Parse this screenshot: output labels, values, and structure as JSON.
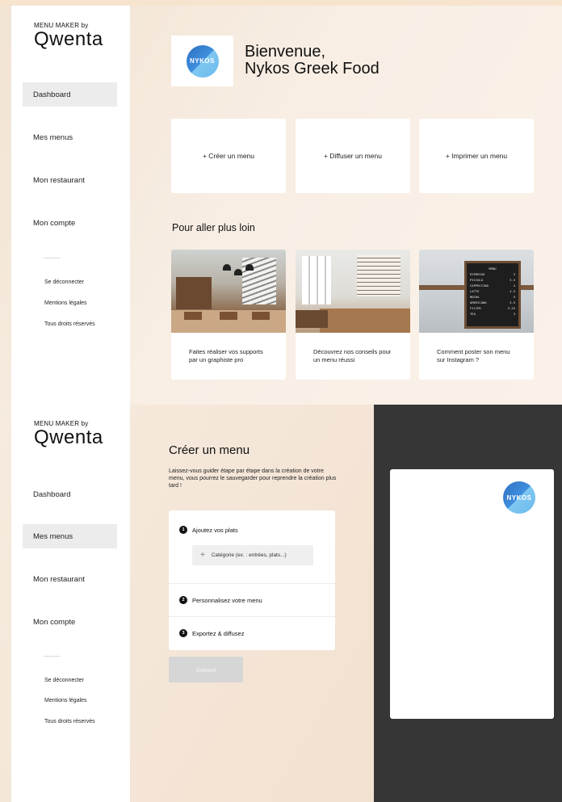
{
  "brand": {
    "small": "MENU MAKER by",
    "big": "Qwenta"
  },
  "screen1": {
    "sidebar": {
      "items": [
        {
          "label": "Dashboard",
          "active": true
        },
        {
          "label": "Mes menus",
          "active": false
        },
        {
          "label": "Mon restaurant",
          "active": false
        },
        {
          "label": "Mon compte",
          "active": false
        }
      ],
      "footer": [
        "Se déconnecter",
        "Mentions légales",
        "Tous droits réservés"
      ]
    },
    "logo_text": "NYKOS",
    "welcome": {
      "line1": "Bienvenue,",
      "line2": "Nykos Greek Food"
    },
    "actions": [
      "+ Créer un menu",
      "+ Diffuser un menu",
      "+ Imprimer un menu"
    ],
    "section_title": "Pour aller plus loin",
    "cards": [
      {
        "text": "Faites réaliser vos supports par un graphiste pro"
      },
      {
        "text": "Découvrez nos conseils pour un menu réussi"
      },
      {
        "text": "Comment poster son menu sur Instagram ?"
      }
    ],
    "chalkboard": {
      "title": "MENU",
      "rows": [
        [
          "ESPRESSO",
          "3"
        ],
        [
          "PICCOLO",
          "3.5"
        ],
        [
          "CAPPUCCINO",
          "4"
        ],
        [
          "LATTE",
          "4.5"
        ],
        [
          "MOCHA",
          "5"
        ],
        [
          "AMERICANO",
          "3.5"
        ],
        [
          "FILTER",
          "3.25"
        ],
        [
          "TEA",
          "3"
        ]
      ]
    }
  },
  "screen2": {
    "sidebar": {
      "items": [
        {
          "label": "Dashboard",
          "active": false
        },
        {
          "label": "Mes menus",
          "active": true
        },
        {
          "label": "Mon restaurant",
          "active": false
        },
        {
          "label": "Mon compte",
          "active": false
        }
      ],
      "footer": [
        "Se déconnecter",
        "Mentions légales",
        "Tous droits réservés"
      ]
    },
    "title": "Créer un menu",
    "description": "Laissez-vous guider étape par étape dans la création de votre menu, vous pourrez le sauvegarder pour reprendre la création plus tard !",
    "steps": [
      {
        "num": "1",
        "label": "Ajoutez vos plats"
      },
      {
        "num": "2",
        "label": "Personnalisez votre menu"
      },
      {
        "num": "3",
        "label": "Exportez & diffusez"
      }
    ],
    "category_placeholder": "Catégorie (ex. : entrées, plats...)",
    "next_label": "Suivant",
    "preview_logo_text": "NYKOS"
  },
  "colors": {
    "accent_dark": "#363636",
    "active_nav": "#ececec",
    "logo_blue": "#3f8fdf"
  }
}
